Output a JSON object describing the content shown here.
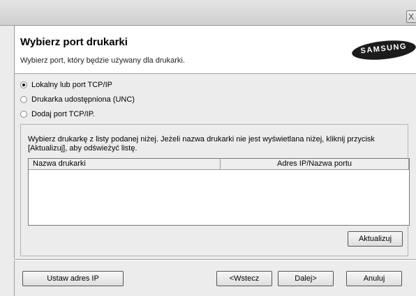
{
  "window": {
    "close_glyph": "X"
  },
  "header": {
    "title": "Wybierz port drukarki",
    "subtitle": "Wybierz port, który będzie używany dla drukarki.",
    "logo_text": "SAMSUNG"
  },
  "port_options": [
    {
      "label": "Lokalny lub port TCP/IP",
      "selected": true
    },
    {
      "label": "Drukarka udostępniona (UNC)",
      "selected": false
    },
    {
      "label": "Dodaj port TCP/IP.",
      "selected": false
    }
  ],
  "printer_group": {
    "instruction_line1": "Wybierz drukarkę z listy podanej niżej. Jeżeli nazwa drukarki nie jest wyświetlana niżej, kliknij przycisk",
    "instruction_line2": "[Aktualizuj], aby odświeżyć listę.",
    "columns": [
      "Nazwa drukarki",
      "Adres IP/Nazwa portu"
    ],
    "rows": [],
    "refresh_label": "Aktualizuj"
  },
  "footer": {
    "set_ip_label": "Ustaw adres IP",
    "back_label": "<Wstecz",
    "next_label": "Dalej>",
    "cancel_label": "Anuluj"
  }
}
